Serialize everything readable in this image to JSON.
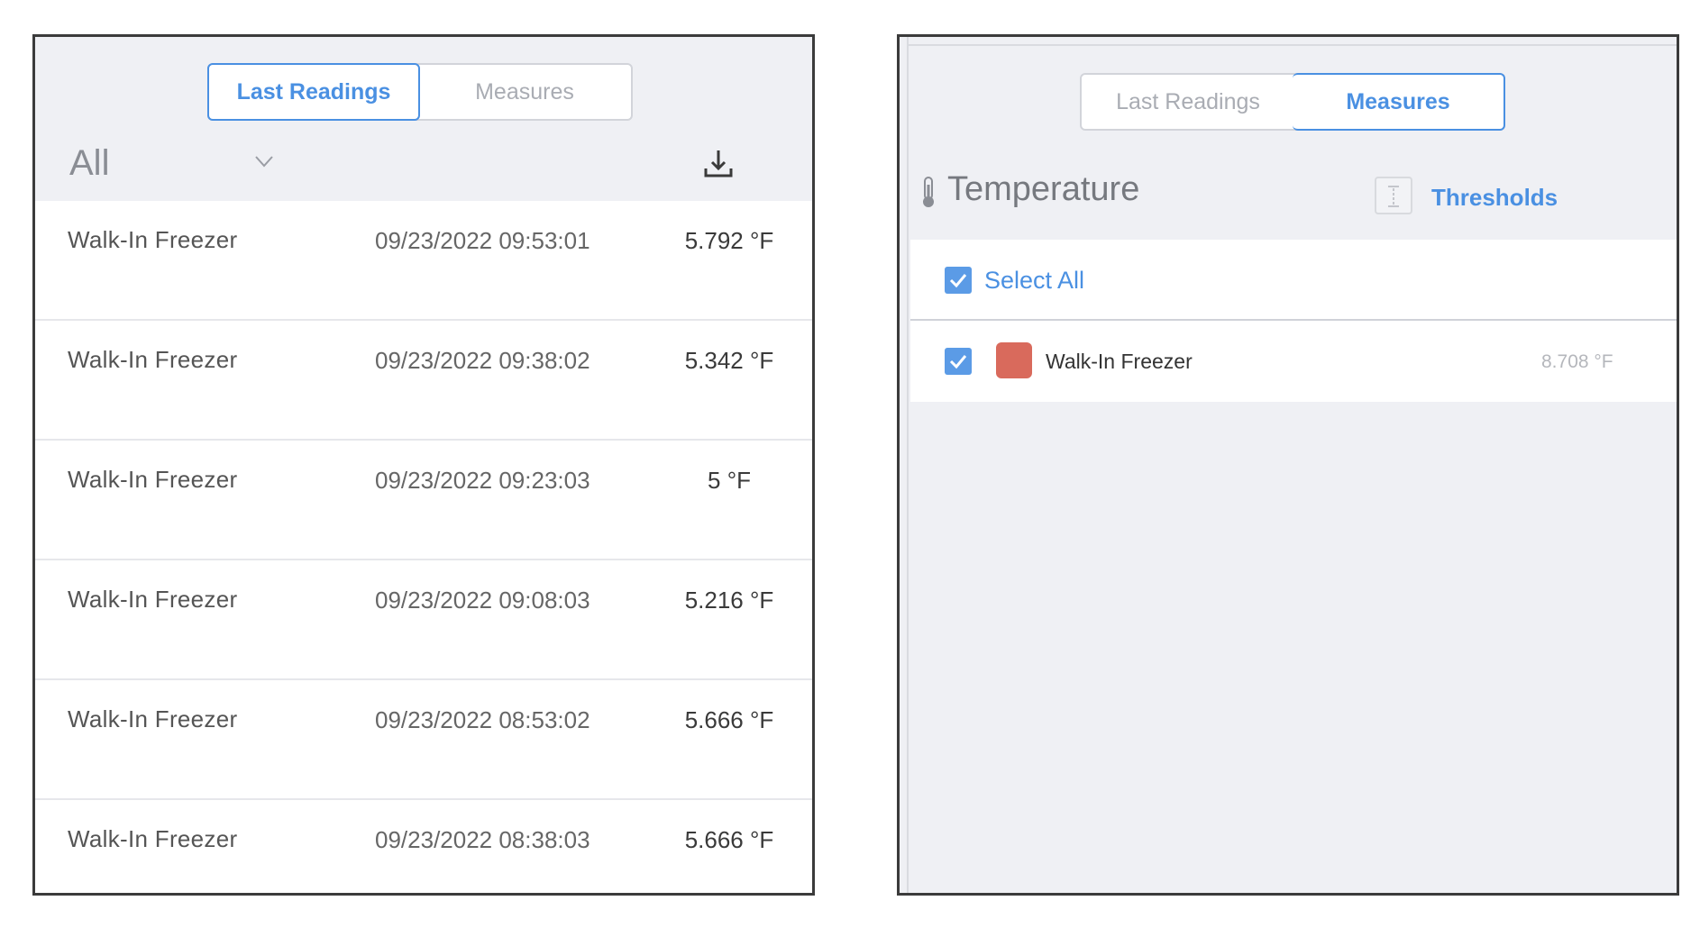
{
  "left_panel": {
    "tabs": [
      {
        "label": "Last Readings",
        "active": true
      },
      {
        "label": "Measures",
        "active": false
      }
    ],
    "filter": {
      "value": "All",
      "icon": "chevron-down-icon"
    },
    "download_icon": "download-icon",
    "readings": [
      {
        "name": "Walk-In Freezer",
        "timestamp": "09/23/2022 09:53:01",
        "value": "5.792 °F"
      },
      {
        "name": "Walk-In Freezer",
        "timestamp": "09/23/2022 09:38:02",
        "value": "5.342 °F"
      },
      {
        "name": "Walk-In Freezer",
        "timestamp": "09/23/2022 09:23:03",
        "value": "5 °F"
      },
      {
        "name": "Walk-In Freezer",
        "timestamp": "09/23/2022 09:08:03",
        "value": "5.216 °F"
      },
      {
        "name": "Walk-In Freezer",
        "timestamp": "09/23/2022 08:53:02",
        "value": "5.666 °F"
      },
      {
        "name": "Walk-In Freezer",
        "timestamp": "09/23/2022 08:38:03",
        "value": "5.666 °F"
      }
    ]
  },
  "right_panel": {
    "tabs": [
      {
        "label": "Last Readings",
        "active": false
      },
      {
        "label": "Measures",
        "active": true
      }
    ],
    "section": {
      "icon": "thermometer-icon",
      "title": "Temperature"
    },
    "thresholds": {
      "icon": "thresholds-icon",
      "label": "Thresholds"
    },
    "select_all": {
      "label": "Select All",
      "checked": true
    },
    "sensors": [
      {
        "name": "Walk-In Freezer",
        "value": "8.708 °F",
        "checked": true,
        "color": "#d96a5c"
      }
    ]
  },
  "colors": {
    "accent": "#4a90e2",
    "checkbox": "#5b9be6",
    "panel_bg": "#eff0f4"
  }
}
